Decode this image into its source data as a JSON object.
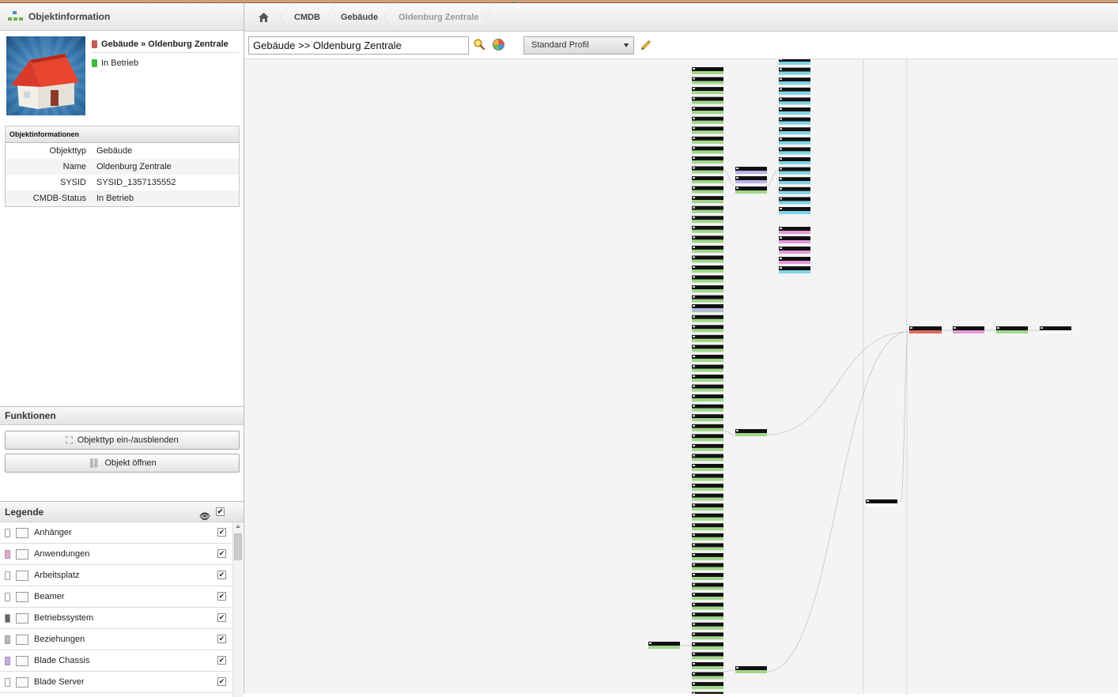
{
  "panel": {
    "title": "Objektinformation"
  },
  "object": {
    "title": "Gebäude » Oldenburg Zentrale",
    "status": "In Betrieb",
    "info_header": "Objektinformationen",
    "rows": [
      {
        "key": "Objekttyp",
        "value": "Gebäude"
      },
      {
        "key": "Name",
        "value": "Oldenburg Zentrale"
      },
      {
        "key": "SYSID",
        "value": "SYSID_1357135552"
      },
      {
        "key": "CMDB-Status",
        "value": "In Betrieb"
      }
    ]
  },
  "functions": {
    "title": "Funktionen",
    "toggle_label": "Objekttyp ein-/ausblenden",
    "open_label": "Objekt öffnen"
  },
  "legend": {
    "title": "Legende",
    "items": [
      {
        "label": "Anhänger",
        "color": "#ffffff"
      },
      {
        "label": "Anwendungen",
        "color": "#e9a9d8"
      },
      {
        "label": "Arbeitsplatz",
        "color": "#ffffff"
      },
      {
        "label": "Beamer",
        "color": "#ffffff"
      },
      {
        "label": "Betriebssystem",
        "color": "#666666"
      },
      {
        "label": "Beziehungen",
        "color": "#bbbbbb"
      },
      {
        "label": "Blade Chassis",
        "color": "#c9a8e8"
      },
      {
        "label": "Blade Server",
        "color": "#ffffff"
      }
    ]
  },
  "breadcrumb": {
    "items": [
      "CMDB",
      "Gebäude",
      "Oldenburg Zentrale"
    ]
  },
  "toolbar": {
    "search_value": "Gebäude >> Oldenburg Zentrale",
    "profile": "Standard Profil"
  },
  "colors": {
    "node_green": "#9fd88a",
    "node_cyan": "#7fd3e8",
    "node_pink": "#e39ad6",
    "node_red": "#e06a58",
    "node_black": "#111111"
  }
}
